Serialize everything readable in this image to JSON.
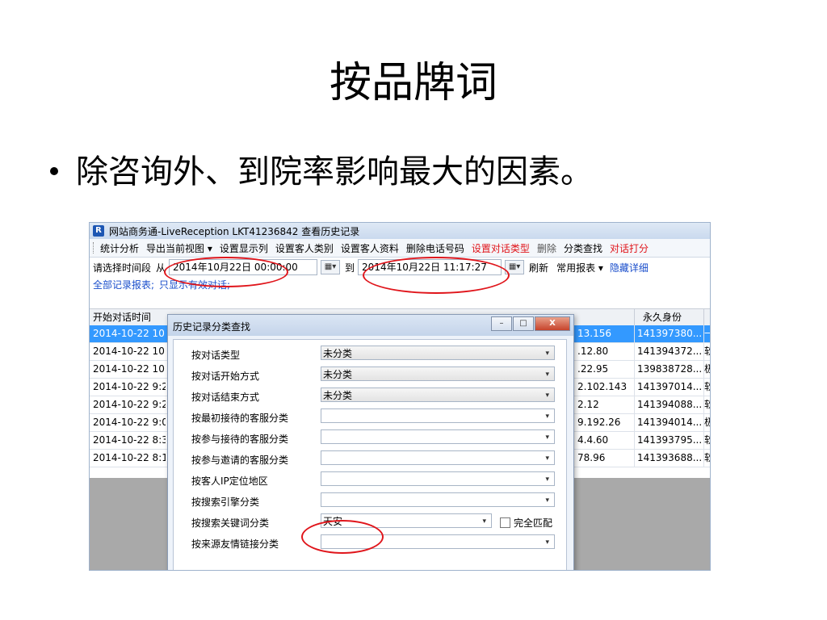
{
  "slide": {
    "title": "按品牌词",
    "bullet": "除咨询外、到院率影响最大的因素。"
  },
  "window": {
    "title": "网站商务通-LiveReception LKT41236842  查看历史记录"
  },
  "menu": [
    {
      "label": "统计分析",
      "style": "normal"
    },
    {
      "label": "导出当前视图 ▾",
      "style": "normal"
    },
    {
      "label": "设置显示列",
      "style": "normal"
    },
    {
      "label": "设置客人类别",
      "style": "normal"
    },
    {
      "label": "设置客人资料",
      "style": "normal"
    },
    {
      "label": "删除电话号码",
      "style": "normal"
    },
    {
      "label": "设置对话类型",
      "style": "red"
    },
    {
      "label": "删除",
      "style": "gray"
    },
    {
      "label": "分类查找",
      "style": "normal"
    },
    {
      "label": "对话打分",
      "style": "red"
    }
  ],
  "filter": {
    "label": "请选择时间段",
    "from_label": "从",
    "from_value": "2014年10月22日 00:00:00",
    "to_label": "到",
    "to_value": "2014年10月22日 11:17:27",
    "refresh": "刷新",
    "common_report": "常用报表 ▾",
    "hide_detail": "隐藏详细"
  },
  "reports": {
    "all": "全部记录报表;",
    "valid_only": "只显示有效对话;"
  },
  "grid": {
    "col_start": "开始对话时间",
    "col_id": "永久身份",
    "rows": [
      {
        "start": "2014-10-22 10:",
        "ip": "13.156",
        "id": "141397380...",
        "extra": "一",
        "selected": true
      },
      {
        "start": "2014-10-22 10:",
        "ip": ".12.80",
        "id": "141394372...",
        "extra": "软",
        "selected": false
      },
      {
        "start": "2014-10-22 10:",
        "ip": ".22.95",
        "id": "139838728...",
        "extra": "极",
        "selected": false
      },
      {
        "start": "2014-10-22 9:2",
        "ip": "2.102.143",
        "id": "141397014...",
        "extra": "软",
        "selected": false
      },
      {
        "start": "2014-10-22 9:2",
        "ip": "2.12",
        "id": "141394088...",
        "extra": "软",
        "selected": false
      },
      {
        "start": "2014-10-22 9:0",
        "ip": "9.192.26",
        "id": "141394014...",
        "extra": "极",
        "selected": false
      },
      {
        "start": "2014-10-22 8:3",
        "ip": "4.4.60",
        "id": "141393795...",
        "extra": "软",
        "selected": false
      },
      {
        "start": "2014-10-22 8:1",
        "ip": "78.96",
        "id": "141393688...",
        "extra": "软",
        "selected": false
      }
    ]
  },
  "dialog": {
    "title": "历史记录分类查找",
    "fields": [
      {
        "label": "按对话类型",
        "value": "未分类"
      },
      {
        "label": "按对话开始方式",
        "value": "未分类"
      },
      {
        "label": "按对话结束方式",
        "value": "未分类"
      },
      {
        "label": "按最初接待的客服分类",
        "value": ""
      },
      {
        "label": "按参与接待的客服分类",
        "value": ""
      },
      {
        "label": "按参与邀请的客服分类",
        "value": ""
      },
      {
        "label": "按客人IP定位地区",
        "value": ""
      },
      {
        "label": "按搜索引擎分类",
        "value": ""
      },
      {
        "label": "按搜索关键词分类",
        "value": "天安"
      },
      {
        "label": "按来源友情链接分类",
        "value": ""
      }
    ],
    "exact_match": "完全匹配"
  },
  "icons": {
    "app_logo": "R",
    "dropdown": "▾",
    "calendar": "▦▾",
    "minimize": "–",
    "maximize": "□",
    "close": "X"
  }
}
